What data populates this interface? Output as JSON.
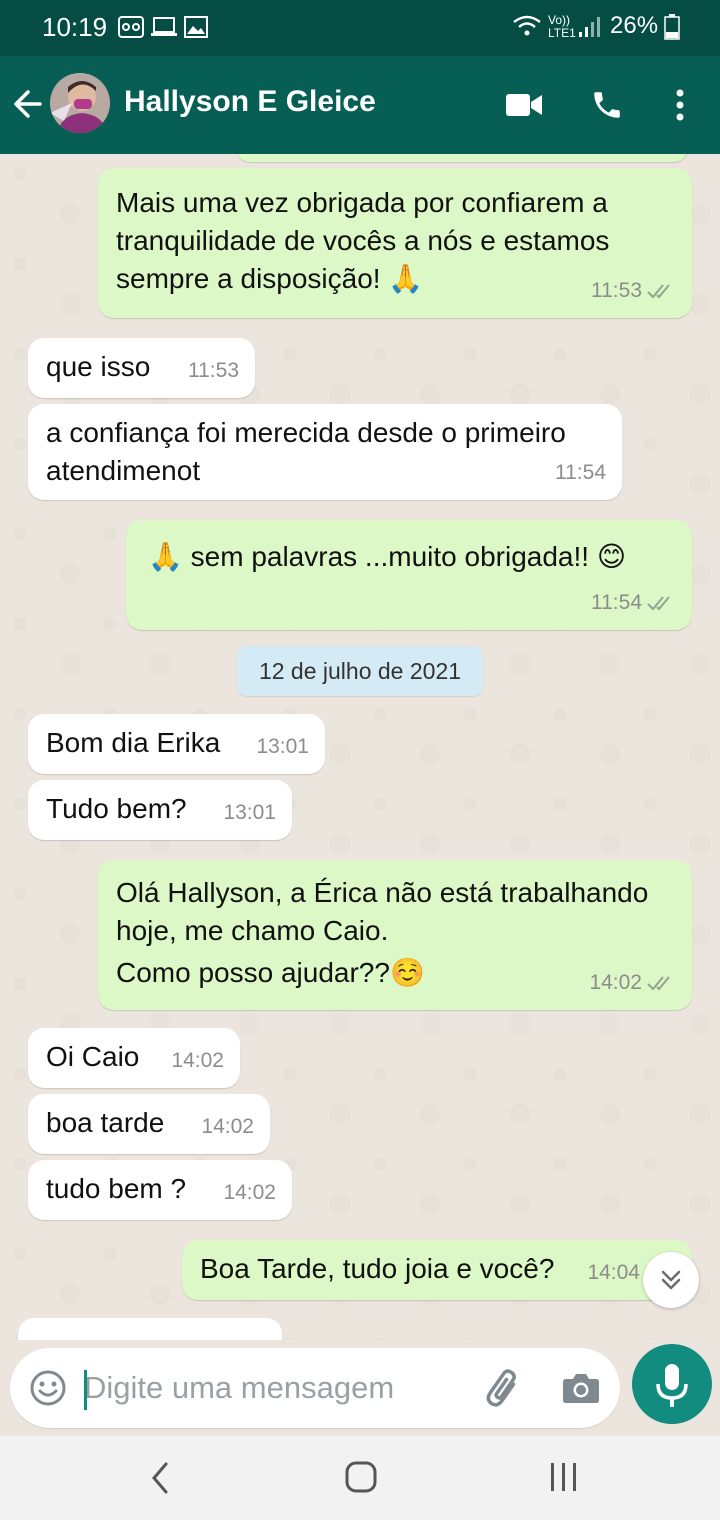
{
  "status_bar": {
    "time": "10:19",
    "network_label": "Vo)) LTE1",
    "battery": "26%"
  },
  "app_bar": {
    "contact_name": "Hallyson E Gleice"
  },
  "messages": [
    {
      "dir": "out",
      "text": "Mais uma vez obrigada por confiarem a tranquilidade de vocês a nós e estamos sempre a disposição! 🙏",
      "time": "11:53"
    },
    {
      "dir": "in",
      "text": "que isso",
      "time": "11:53"
    },
    {
      "dir": "in",
      "text": "a confiança foi merecida desde o primeiro atendimenot",
      "time": "11:54"
    },
    {
      "dir": "out",
      "text": "🙏 sem palavras ...muito obrigada!! 😊",
      "time": "11:54"
    },
    {
      "dir": "in",
      "text": "Bom dia Erika",
      "time": "13:01"
    },
    {
      "dir": "in",
      "text": "Tudo bem?",
      "time": "13:01"
    },
    {
      "dir": "out",
      "text_lines": [
        "Olá Hallyson, a Érica não está trabalhando hoje, me chamo Caio.",
        "Como posso ajudar??☺️"
      ],
      "time": "14:02"
    },
    {
      "dir": "in",
      "text": "Oi Caio",
      "time": "14:02"
    },
    {
      "dir": "in",
      "text": "boa tarde",
      "time": "14:02"
    },
    {
      "dir": "in",
      "text": "tudo bem ?",
      "time": "14:02"
    },
    {
      "dir": "out",
      "text": "Boa Tarde, tudo joia e você?",
      "time": "14:04"
    }
  ],
  "date_separator": "12 de julho de 2021",
  "composer": {
    "placeholder": "Digite uma mensagem"
  },
  "colors": {
    "header": "#075e54",
    "status_bar": "#054d44",
    "outgoing_bubble": "#dcf8c6",
    "incoming_bubble": "#ffffff",
    "accent": "#128c7e",
    "date_pill": "#d4eaf4"
  },
  "icons": [
    "back-arrow-icon",
    "video-call-icon",
    "voice-call-icon",
    "more-options-icon",
    "emoji-icon",
    "attach-icon",
    "camera-icon",
    "mic-icon",
    "scroll-down-icon",
    "double-check-icon",
    "nav-back-icon",
    "nav-home-icon",
    "nav-recents-icon"
  ]
}
